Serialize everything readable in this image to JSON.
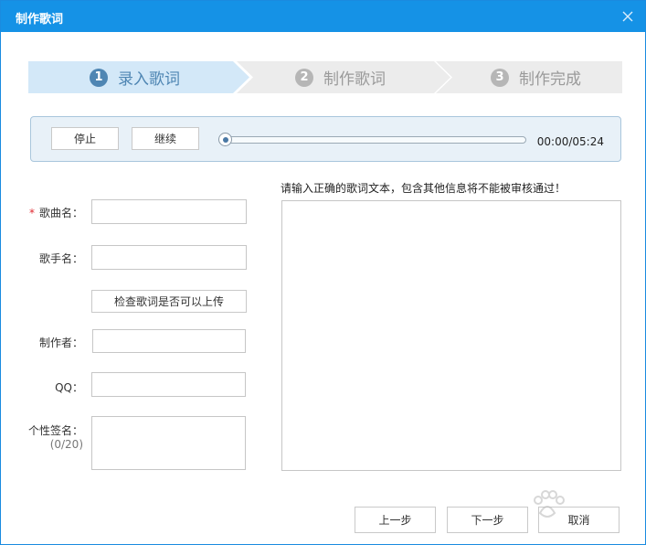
{
  "window": {
    "title": "制作歌词"
  },
  "steps": [
    {
      "number": "1",
      "label": "录入歌词",
      "state": "active"
    },
    {
      "number": "2",
      "label": "制作歌词",
      "state": "inactive"
    },
    {
      "number": "3",
      "label": "制作完成",
      "state": "inactive"
    }
  ],
  "player": {
    "stop_label": "停止",
    "continue_label": "继续",
    "time": "00:00/05:24",
    "progress": 0
  },
  "form": {
    "required_mark": "*",
    "song_name_label": "歌曲名：",
    "singer_label": "歌手名：",
    "check_button": "检查歌词是否可以上传",
    "author_label": "制作者：",
    "qq_label": "QQ：",
    "signature_label": "个性签名：",
    "signature_count": "(0/20)"
  },
  "lyrics": {
    "hint": "请输入正确的歌词文本，包含其他信息将不能被审核通过！"
  },
  "footer": {
    "prev_label": "上一步",
    "next_label": "下一步",
    "cancel_label": "取消"
  },
  "colors": {
    "titlebar": "#1592e6",
    "active_step_bg": "#d3e8f8",
    "active_step_text": "#4f86b3",
    "inactive_step_bg": "#ececec",
    "required": "#e0282f"
  }
}
